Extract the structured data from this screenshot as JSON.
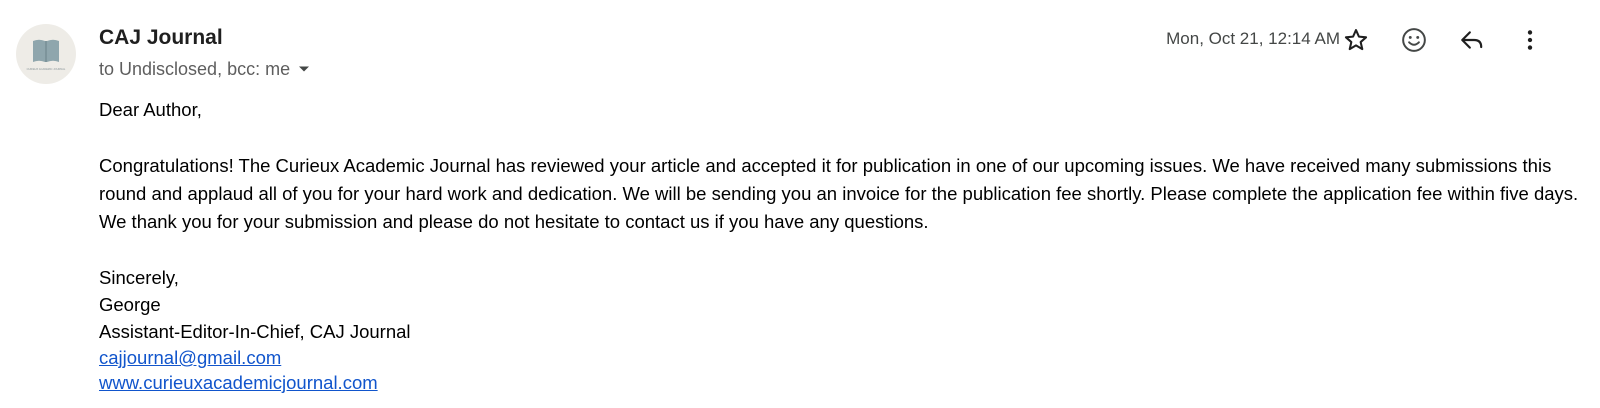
{
  "sender": {
    "name": "CAJ Journal",
    "recipients_text": "to Undisclosed, bcc: me",
    "avatar_text": "CURIEUX ACADEMIC JOURNAL",
    "avatar_icon": "open-book-icon"
  },
  "header": {
    "timestamp": "Mon, Oct 21, 12:14 AM"
  },
  "actions": {
    "star_icon": "star-icon",
    "emoji_icon": "emoji-reaction-icon",
    "reply_icon": "reply-icon",
    "more_icon": "more-vert-icon"
  },
  "body": {
    "greeting": "Dear Author,",
    "paragraph": "Congratulations! The Curieux Academic Journal has reviewed your article and accepted it for publication in one of our upcoming issues. We have received many submissions this round and applaud all of you for your hard work and dedication. We will be sending you an invoice for the publication fee shortly. Please complete the application fee within five days. We thank you for your submission and please do not hesitate to contact us if you have any questions.",
    "signoff": "Sincerely,",
    "signer_name": "George",
    "signer_title": "Assistant-Editor-In-Chief, CAJ Journal",
    "email_link": "cajjournal@gmail.com",
    "website_link": "www.curieuxacademicjournal.com "
  },
  "colors": {
    "link": "#1155cc",
    "avatar_bg": "#eeece7",
    "avatar_icon": "#8fa6ad",
    "secondary_text": "#5e5e5e"
  }
}
